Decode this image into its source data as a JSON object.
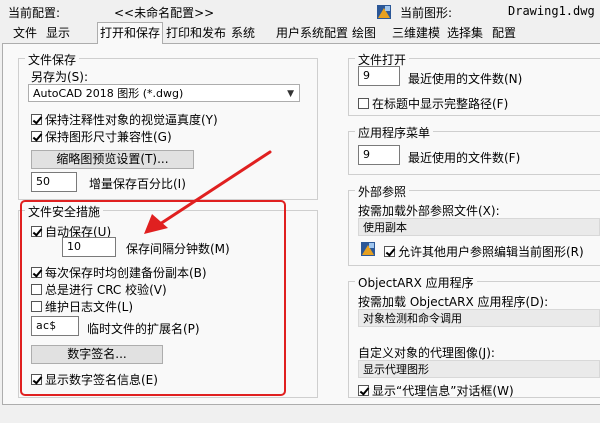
{
  "header": {
    "current_config_label": "当前配置:",
    "current_config_value": "<<未命名配置>>",
    "current_drawing_label": "当前图形:",
    "current_drawing_value": "Drawing1.dwg"
  },
  "tabs": [
    "文件",
    "显示",
    "打开和保存",
    "打印和发布",
    "系统",
    "用户系统配置",
    "绘图",
    "三维建模",
    "选择集",
    "配置"
  ],
  "file_save": {
    "title": "文件保存",
    "save_as_label": "另存为(S):",
    "save_as_value": "AutoCAD 2018 图形 (*.dwg)",
    "keep_annotative": "保持注释性对象的视觉逼真度(Y)",
    "keep_size_compat": "保持图形尺寸兼容性(G)",
    "thumbnail_button": "缩略图预览设置(T)...",
    "incremental_value": "50",
    "incremental_label": "增量保存百分比(I)"
  },
  "file_safety": {
    "title": "文件安全措施",
    "autosave": "自动保存(U)",
    "autosave_minutes_value": "10",
    "autosave_minutes_label": "保存间隔分钟数(M)",
    "backup_copy": "每次保存时均创建备份副本(B)",
    "crc_check": "总是进行 CRC 校验(V)",
    "log_file": "维护日志文件(L)",
    "temp_ext_value": "ac$",
    "temp_ext_label": "临时文件的扩展名(P)",
    "digital_sign_button": "数字签名...",
    "show_digital_sign": "显示数字签名信息(E)"
  },
  "file_open": {
    "title": "文件打开",
    "recent_value": "9",
    "recent_label": "最近使用的文件数(N)",
    "full_path_title": "在标题中显示完整路径(F)"
  },
  "app_menu": {
    "title": "应用程序菜单",
    "recent_value": "9",
    "recent_label": "最近使用的文件数(F)"
  },
  "xref": {
    "title": "外部参照",
    "demand_load_label": "按需加载外部参照文件(X):",
    "demand_load_value": "使用副本",
    "allow_edit": "允许其他用户参照编辑当前图形(R)"
  },
  "objectarx": {
    "title": "ObjectARX 应用程序",
    "demand_load_label": "按需加载 ObjectARX 应用程序(D):",
    "demand_load_value": "对象检测和命令调用",
    "proxy_image_label": "自定义对象的代理图像(J):",
    "proxy_image_value": "显示代理图形",
    "show_proxy_dialog": "显示“代理信息”对话框(W)"
  },
  "colors": {
    "highlight_border": "#e02020"
  }
}
